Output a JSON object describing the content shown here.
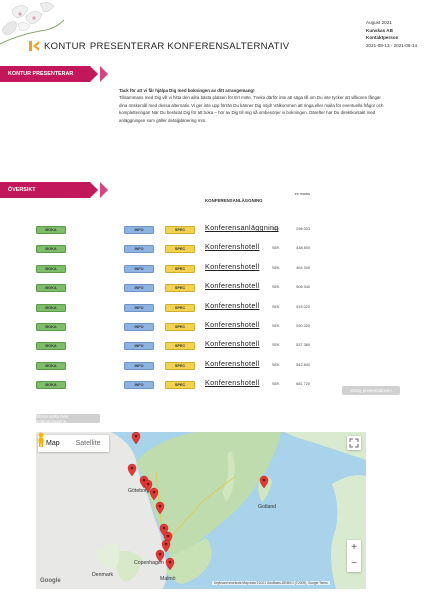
{
  "header": {
    "brand": "KONTUR",
    "tagline": "PRESENTERAR KONFERENSALTERNATIV",
    "month": "August 2021",
    "customer": "Kunskas AB",
    "contact": "Kontaktperson",
    "dates": "2021-08-13 - 2021-08-14"
  },
  "intro_section": {
    "ribbon": "KONTUR PRESENTERAR",
    "heading": "Tack för att vi får hjälpa Dig med bokningen av ditt arrangemang!",
    "body": "Tillsammans med Dig vill vi hitta den allra bästa platsen för Ert möte. Tveka därför inte att säga till om Du inte tycker att villkoren fångar dina önskemål med dessa alternativ. Vi ger inte upp förrän Du känner Dig nöjd! Välkommen att ringa eller maila för eventuella frågor och kompletteringar! När Du beslutat Dig för att boka – hör av Dig till mig så ombesörjer vi bokningen. Därefter har Du direktkontakt med anläggningen som gäller detaljplanering mm."
  },
  "overview": {
    "ribbon": "ÖVERSIKT",
    "col_venue": "KONFERENSANLÄGGNING",
    "col_price": "ex moms",
    "boka_label": "BOKA",
    "info_label": "INFO",
    "spec_label": "SPEC",
    "currency": "SEK",
    "rows": [
      {
        "venue": "Konferensanläggning",
        "price": "298 003"
      },
      {
        "venue": "Konferenshotell",
        "price": "438 800"
      },
      {
        "venue": "Konferenshotell",
        "price": "464 300"
      },
      {
        "venue": "Konferenshotell",
        "price": "508 340"
      },
      {
        "venue": "Konferenshotell",
        "price": "515 020"
      },
      {
        "venue": "Konferenshotell",
        "price": "530 320"
      },
      {
        "venue": "Konferenshotell",
        "price": "537 360"
      },
      {
        "venue": "Konferenshotell",
        "price": "542 840"
      },
      {
        "venue": "Konferenshotell",
        "price": "681 720"
      }
    ],
    "close_button": "Stäng presentationen",
    "map_button": "Större karta över anläggningarna"
  },
  "map": {
    "tab_map": "Map",
    "tab_satellite": "Satellite",
    "labels": {
      "goteborg": "Göteborg",
      "denmark": "Denmark",
      "copenhagen": "Copenhagen",
      "malmo": "Malmö",
      "gotland": "Gotland"
    },
    "attribution": "Keyboard shortcuts   Map data ©2021 GeoBasis-DE/BKG (©2009), Google   Terms",
    "google": "Google",
    "marker_color": "#e53935",
    "accent": "#c2185b"
  }
}
